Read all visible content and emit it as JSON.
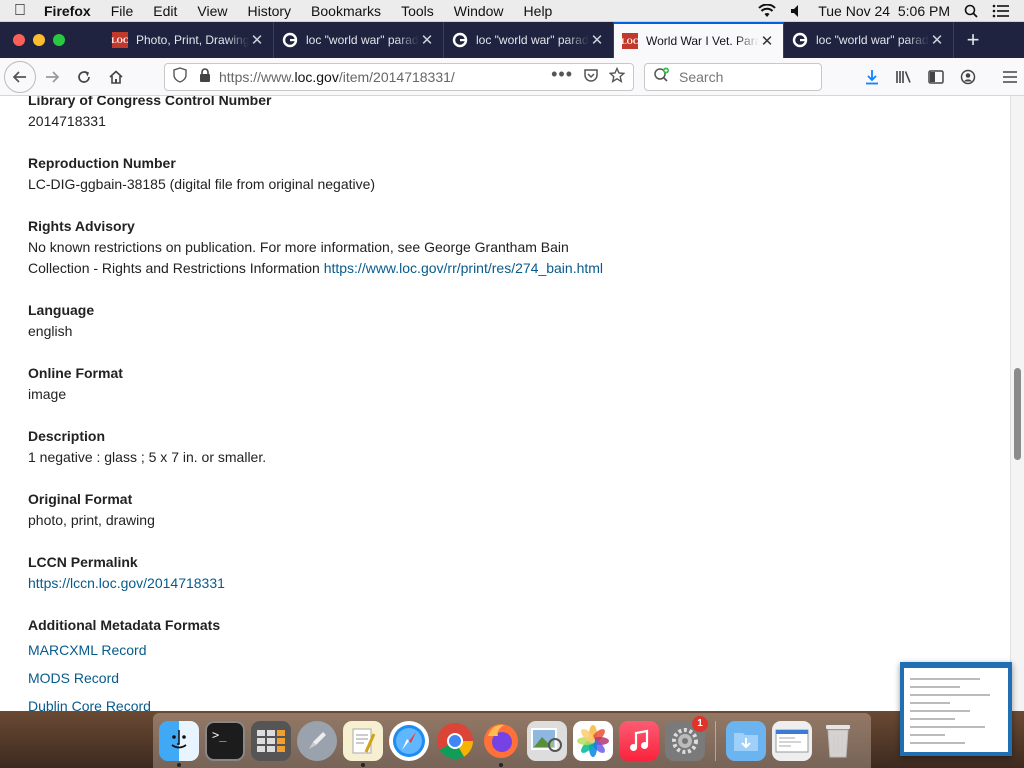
{
  "menubar": {
    "app_name": "Firefox",
    "items": [
      "File",
      "Edit",
      "View",
      "History",
      "Bookmarks",
      "Tools",
      "Window",
      "Help"
    ],
    "clock": "Tue Nov 24  5:06 PM"
  },
  "tabs": [
    {
      "title": "Photo, Print, Drawing",
      "favicon": "loc",
      "active": false
    },
    {
      "title": "loc \"world war\" parade",
      "favicon": "google",
      "active": false
    },
    {
      "title": "loc \"world war\" parade",
      "favicon": "google",
      "active": false
    },
    {
      "title": "World War I Vet. Parade",
      "favicon": "loc",
      "active": true
    },
    {
      "title": "loc \"world war\" parade",
      "favicon": "google",
      "active": false
    }
  ],
  "favicon_loc_text": "LOC",
  "navbar": {
    "url_prefix": "https://www.",
    "url_host": "loc.gov",
    "url_rest": "/item/2014718331/",
    "search_placeholder": "Search"
  },
  "fields": {
    "lccn_label": "Library of Congress Control Number",
    "lccn_value": "2014718331",
    "repro_label": "Reproduction Number",
    "repro_value": "LC-DIG-ggbain-38185 (digital file from original negative)",
    "rights_label": "Rights Advisory",
    "rights_line1": "No known restrictions on publication. For more information, see George Grantham Bain",
    "rights_line2": "Collection - Rights and Restrictions Information",
    "rights_link": "https://www.loc.gov/rr/print/res/274_bain.html",
    "language_label": "Language",
    "language_value": "english",
    "online_format_label": "Online Format",
    "online_format_value": "image",
    "description_label": "Description",
    "description_value": "1 negative : glass ; 5 x 7 in. or smaller.",
    "original_format_label": "Original Format",
    "original_format_value": "photo, print, drawing",
    "permalink_label": "LCCN Permalink",
    "permalink_value": "https://lccn.loc.gov/2014718331",
    "metadata_label": "Additional Metadata Formats",
    "metadata_links": [
      "MARCXML Record",
      "MODS Record",
      "Dublin Core Record"
    ]
  },
  "dock": {
    "items": [
      "finder",
      "terminal",
      "calculator",
      "launchpad",
      "textedit",
      "safari",
      "chrome",
      "firefox",
      "preview",
      "photos",
      "music",
      "system-preferences",
      "downloads",
      "screenshot",
      "trash"
    ],
    "system_preferences_badge": "1"
  },
  "colors": {
    "tabbar": "#202340",
    "link": "#075b8c",
    "active_tab_accent": "#0060df"
  }
}
